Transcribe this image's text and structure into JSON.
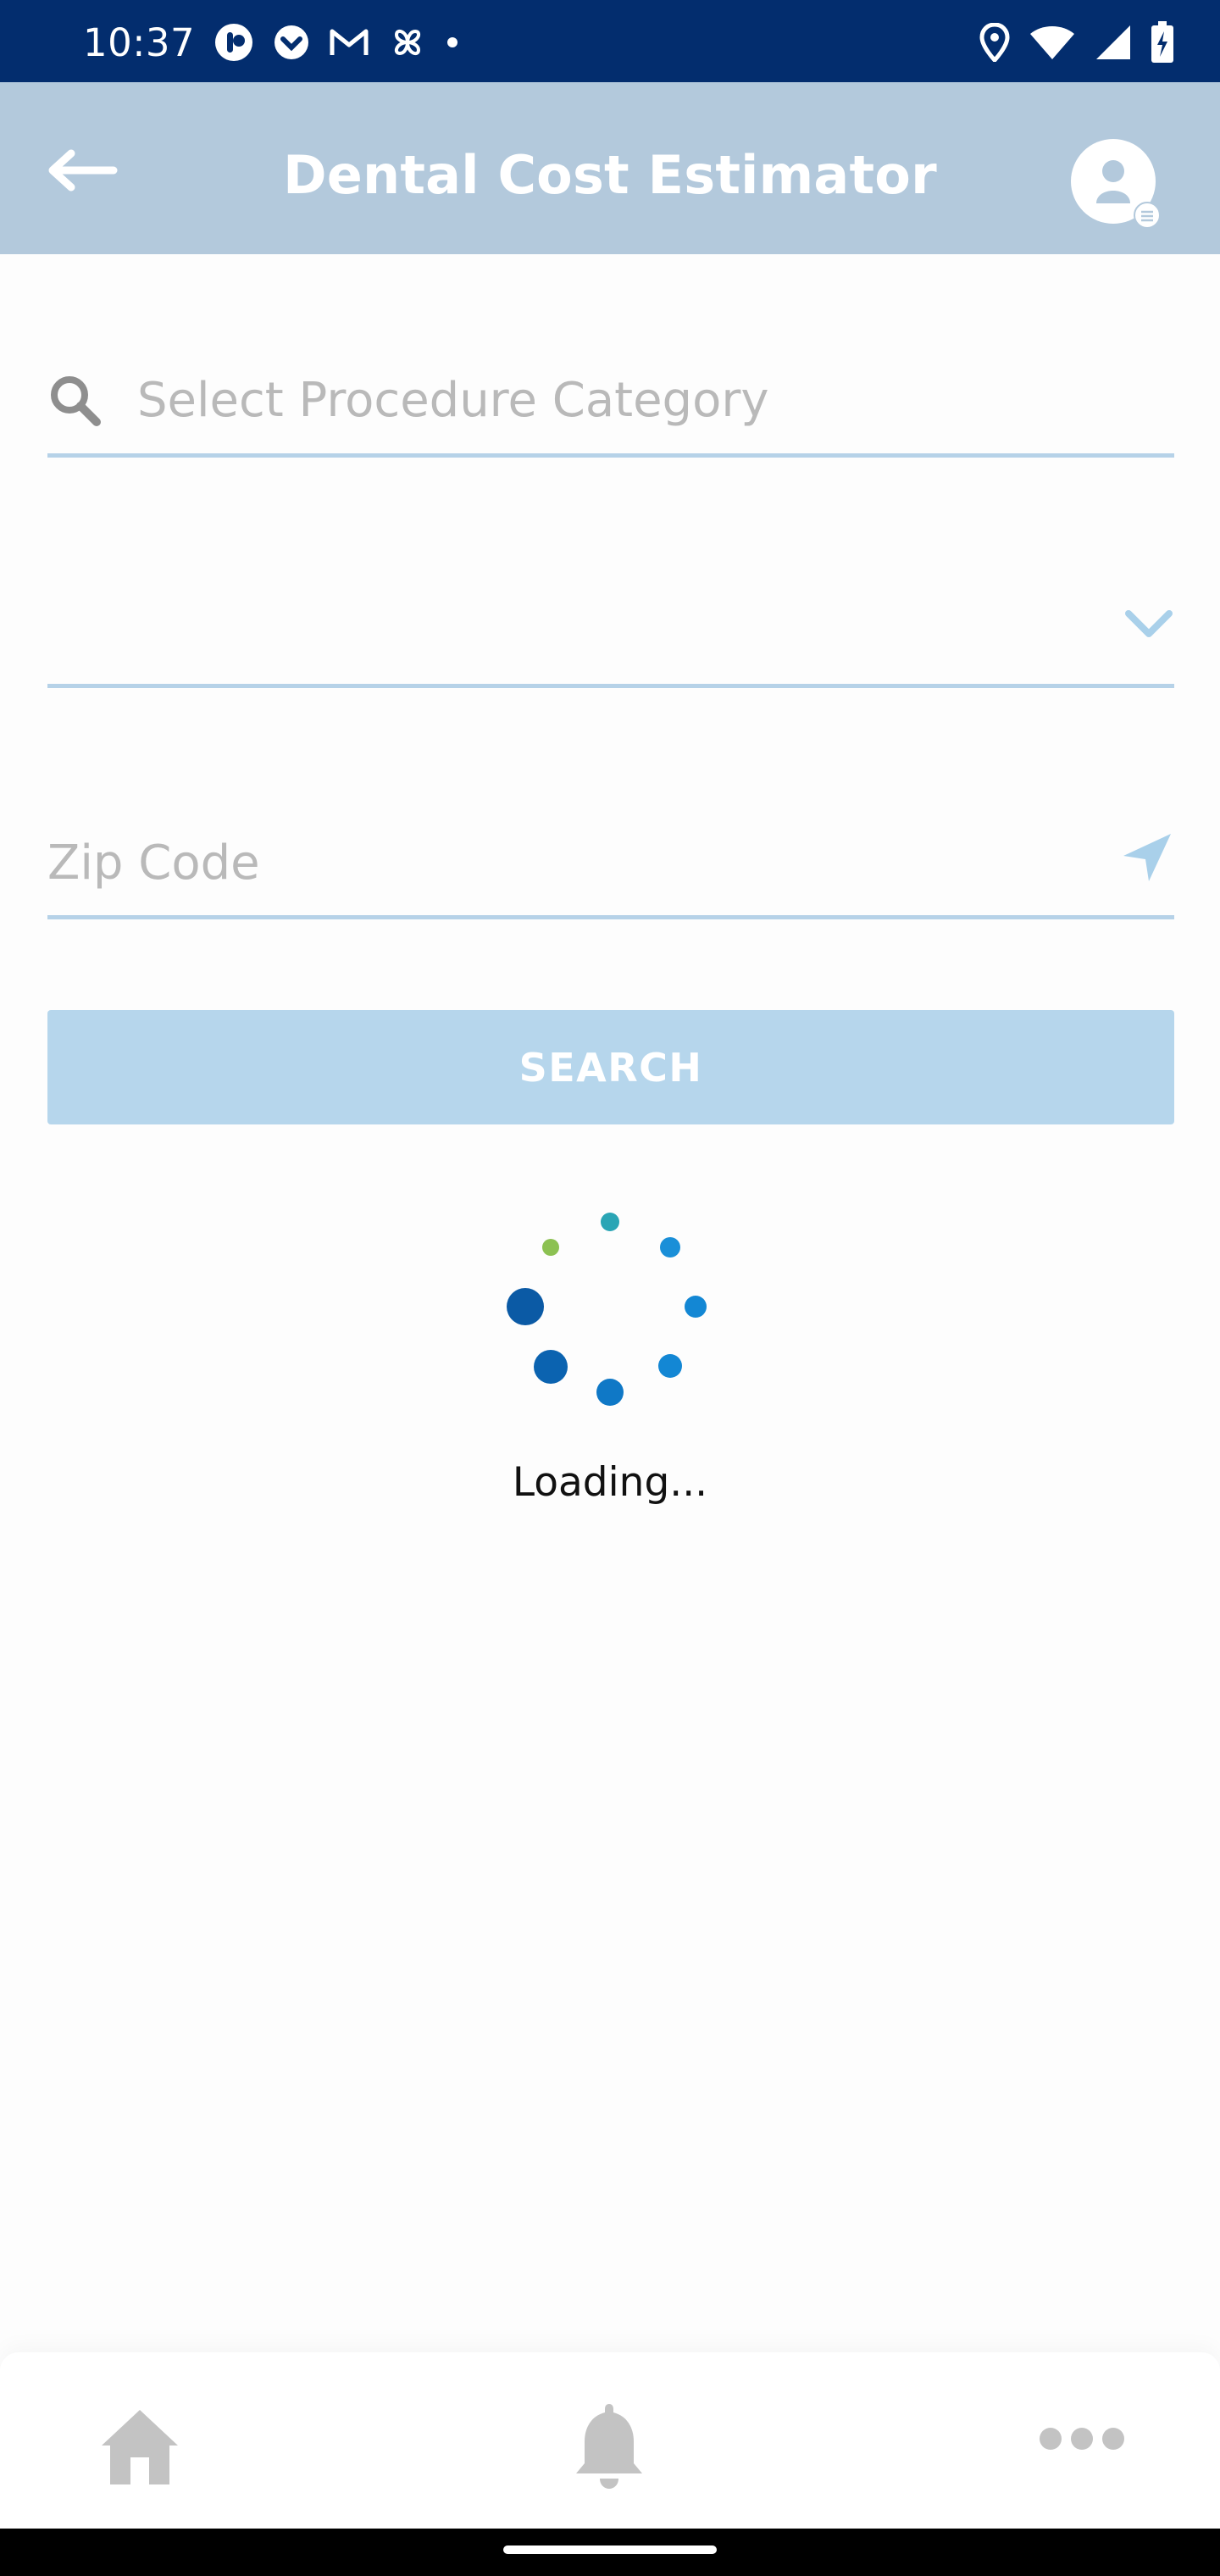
{
  "status_bar": {
    "time": "10:37",
    "left_icons": [
      "app-notification-icon",
      "pocket-icon",
      "gmail-icon",
      "pinwheel-icon",
      "dot-icon"
    ],
    "right_icons": [
      "location-icon",
      "wifi-icon",
      "signal-icon",
      "battery-icon"
    ]
  },
  "header": {
    "title": "Dental Cost Estimator",
    "back_icon": "arrow-left-icon",
    "profile_icon": "profile-icon",
    "background": "#b3c9dc"
  },
  "form": {
    "search_placeholder": "Select Procedure Category",
    "dropdown_value": "",
    "zip_placeholder": "Zip Code",
    "search_button": "SEARCH"
  },
  "loading": {
    "text": "Loading..."
  },
  "bottom_nav": {
    "items": [
      "home-icon",
      "bell-icon",
      "more-icon"
    ]
  },
  "colors": {
    "status_bar": "#032d6e",
    "field_underline": "#b6d2e8",
    "button": "#b6d6ec",
    "spinner_dark": "#0b5aa5",
    "spinner_mid": "#1387d4",
    "spinner_teal": "#2aa5b5",
    "spinner_green": "#8cc152"
  }
}
